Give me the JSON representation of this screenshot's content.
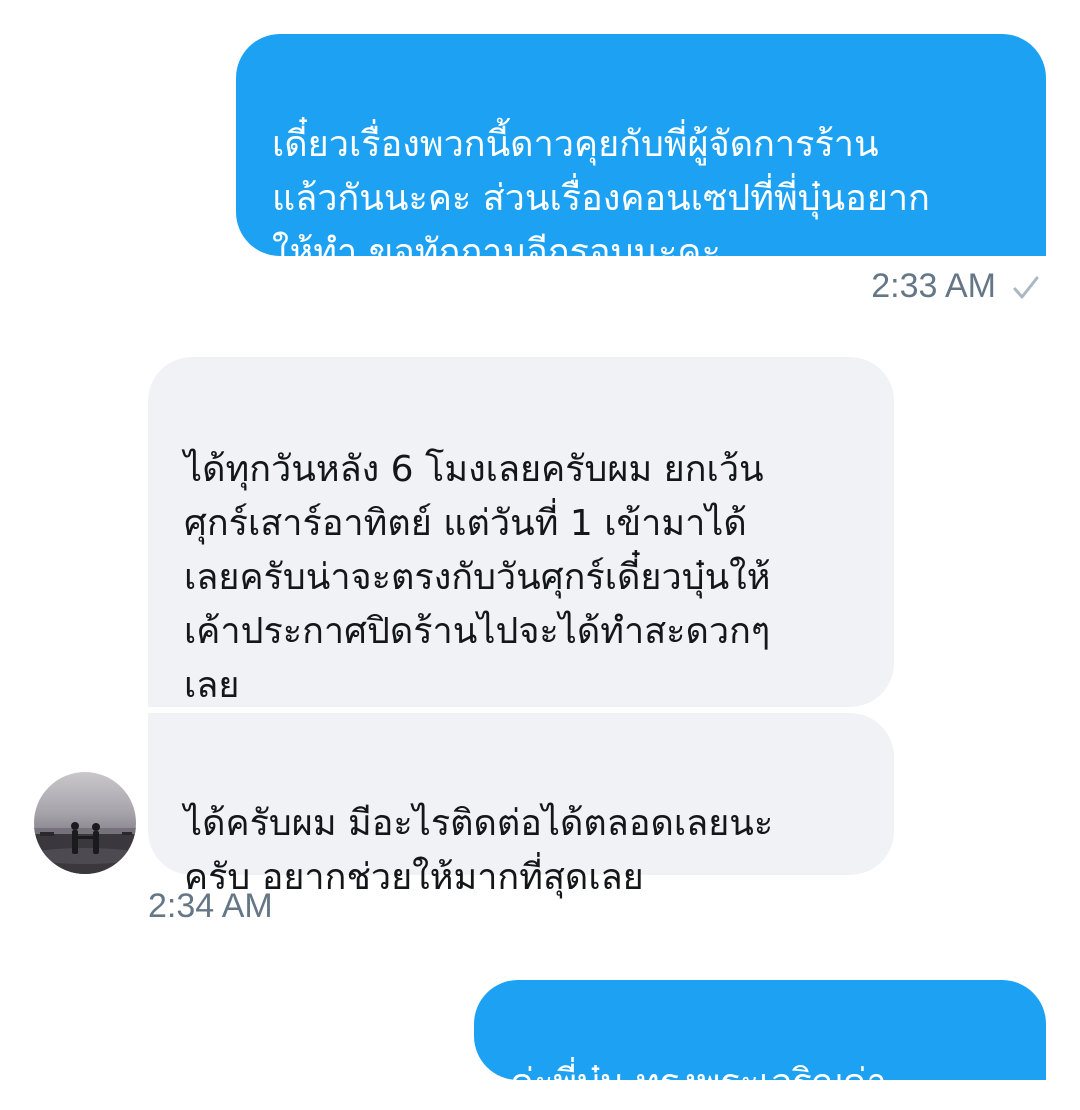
{
  "conversation": {
    "messages": [
      {
        "direction": "outgoing",
        "text": "เดี๋ยวเรื่องพวกนี้ดาวคุยกับพี่ผู้จัดการร้าน\nแล้วกันนะคะ ส่วนเรื่องคอนเซปที่พี่บุ๋นอยาก\nให้ทำ ขอทักถามอีกรอบนะคะ"
      },
      {
        "direction": "incoming",
        "text": "ได้ทุกวันหลัง 6 โมงเลยครับผม ยกเว้น\nศุกร์เสาร์อาทิตย์ แต่วันที่ 1 เข้ามาได้\nเลยครับน่าจะตรงกับวันศุกร์เดี๋ยวบุ๋นให้\nเค้าประกาศปิดร้านไปจะได้ทำสะดวกๆ\nเลย"
      },
      {
        "direction": "incoming",
        "text": "ได้ครับผม มีอะไรติดต่อได้ตลอดเลยนะ\nครับ อยากช่วยให้มากที่สุดเลย"
      },
      {
        "direction": "outgoing",
        "text": "ค่ะพี่บุ๋น ทรงพระเจริญค่า"
      }
    ],
    "timestamps": {
      "outgoing_group_1": "2:33 AM",
      "incoming_group_1": "2:34 AM"
    },
    "status_icon": "checkmark-icon",
    "avatar_icon": "user-avatar-sunset-photo"
  },
  "colors": {
    "outgoing_bubble": "#1da1f2",
    "incoming_bubble": "#f0f2f5",
    "timestamp_text": "#657786"
  }
}
